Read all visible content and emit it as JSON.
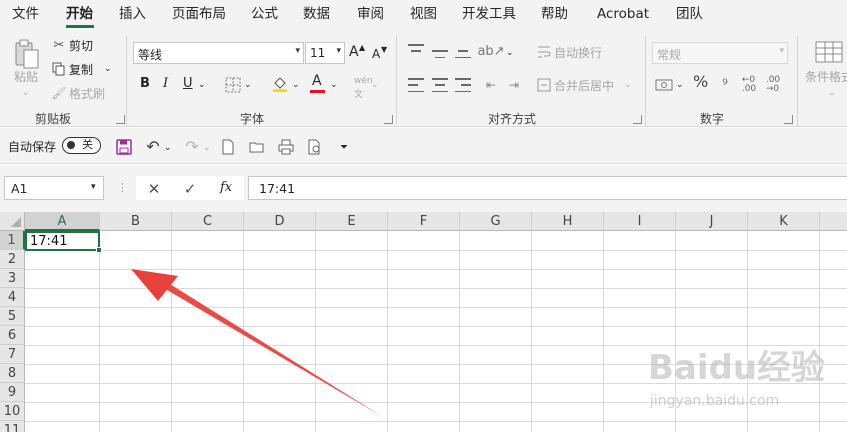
{
  "menu": {
    "items": [
      "文件",
      "开始",
      "插入",
      "页面布局",
      "公式",
      "数据",
      "审阅",
      "视图",
      "开发工具",
      "帮助",
      "Acrobat",
      "团队"
    ],
    "active_index": 1
  },
  "ribbon": {
    "clipboard": {
      "paste_label": "粘贴",
      "cut_label": "剪切",
      "copy_label": "复制",
      "format_painter_label": "格式刷",
      "group_label": "剪贴板"
    },
    "font": {
      "font_name": "等线",
      "font_size": "11",
      "bold_label": "B",
      "italic_label": "I",
      "underline_label": "U",
      "grow_label": "A",
      "shrink_label": "A",
      "font_color_label": "A",
      "group_label": "字体",
      "font_color_hex": "#e81123",
      "fill_color_hex": "#ffd800"
    },
    "alignment": {
      "wrap_text_label": "自动换行",
      "merge_center_label": "合并后居中",
      "group_label": "对齐方式"
    },
    "number": {
      "format_value": "常规",
      "percent_label": "%",
      "group_label": "数字"
    },
    "styles": {
      "conditional_format_label": "条件格式"
    }
  },
  "qat": {
    "autosave_label": "自动保存",
    "autosave_state": "关"
  },
  "formula_bar": {
    "name_box": "A1",
    "fx_label": "fx",
    "content": "17:41"
  },
  "sheet": {
    "columns": [
      "A",
      "B",
      "C",
      "D",
      "E",
      "F",
      "G",
      "H",
      "I",
      "J",
      "K"
    ],
    "rows": [
      "1",
      "2",
      "3",
      "4",
      "5",
      "6",
      "7",
      "8",
      "9",
      "10",
      "11"
    ],
    "selected_cell": "A1",
    "cell_a1": "17:41"
  },
  "annotation": {
    "arrow_color": "#e8413c"
  },
  "watermark": {
    "main": "Baidu经验",
    "sub": "jingyan.baidu.com"
  },
  "colors": {
    "accent": "#217346",
    "ribbon_bg": "#f3f3f3"
  }
}
